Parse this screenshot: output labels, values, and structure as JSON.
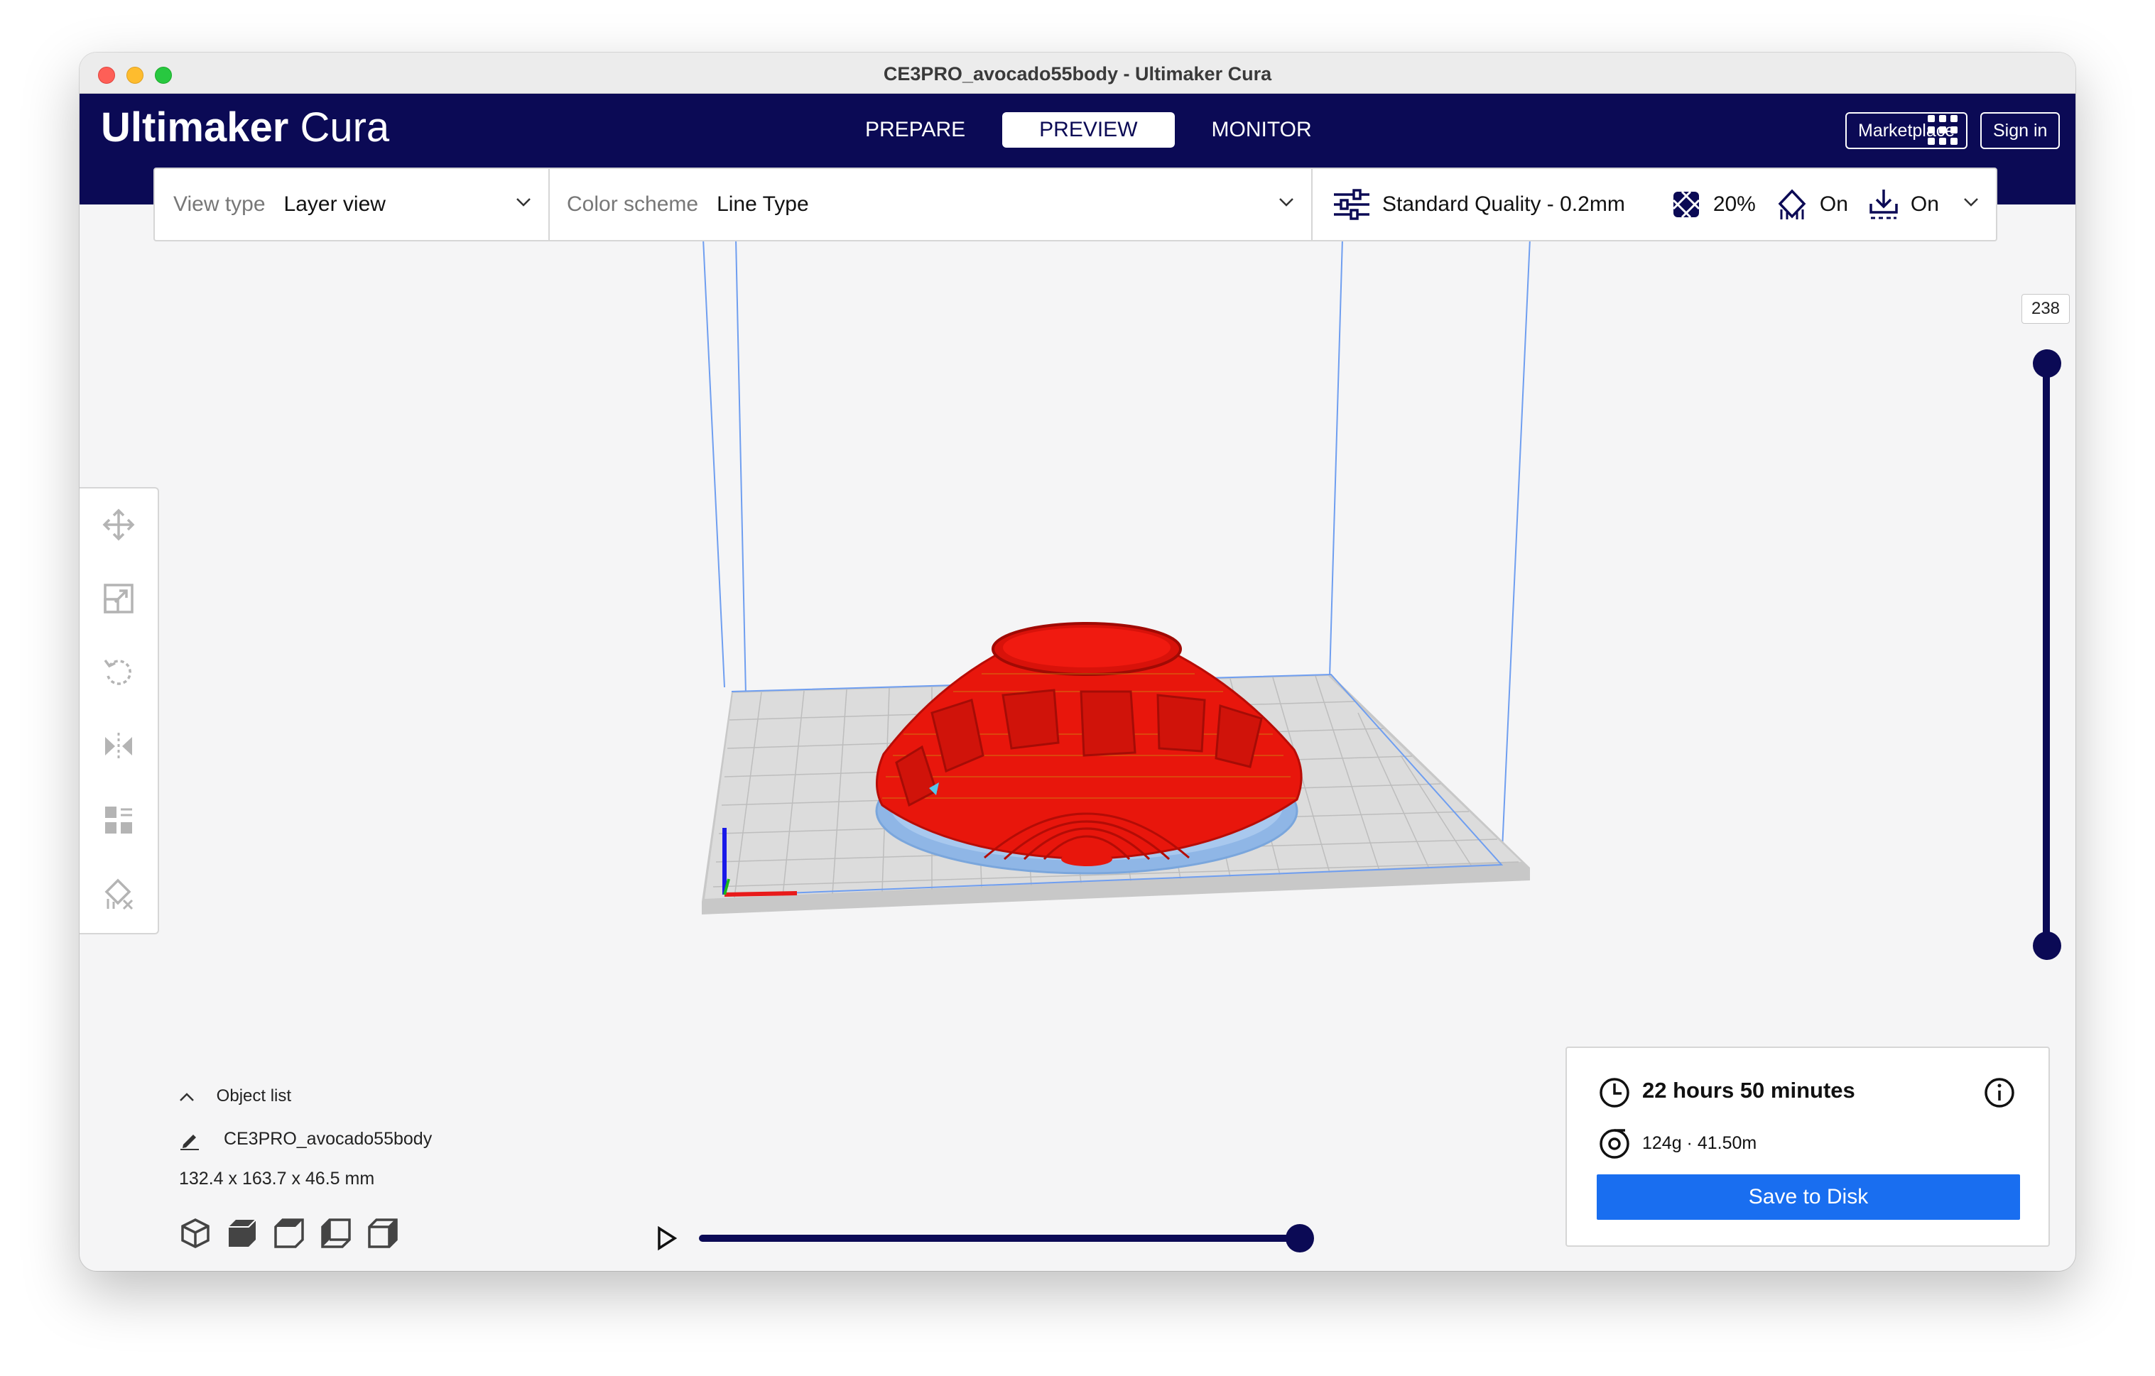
{
  "window": {
    "title": "CE3PRO_avocado55body - Ultimaker Cura"
  },
  "header": {
    "logo_bold": "Ultimaker",
    "logo_light": "Cura",
    "tabs": [
      {
        "label": "PREPARE",
        "active": false
      },
      {
        "label": "PREVIEW",
        "active": true
      },
      {
        "label": "MONITOR",
        "active": false
      }
    ],
    "marketplace_label": "Marketplace",
    "sign_in_label": "Sign in"
  },
  "toolbar": {
    "view_type_label": "View type",
    "view_type_value": "Layer view",
    "color_scheme_label": "Color scheme",
    "color_scheme_value": "Line Type",
    "quality": "Standard Quality - 0.2mm",
    "infill": "20%",
    "support": "On",
    "adhesion": "On"
  },
  "layer_slider": {
    "current_layer": "238",
    "top_fraction": 1.0,
    "bottom_fraction": 0.0
  },
  "object_list": {
    "heading": "Object list",
    "object_name": "CE3PRO_avocado55body",
    "dimensions": "132.4 x 163.7 x 46.5 mm"
  },
  "simulation": {
    "progress": 1.0
  },
  "print_info": {
    "time": "22 hours 50 minutes",
    "material": "124g · 41.50m",
    "save_label": "Save to Disk"
  },
  "colors": {
    "header_bg": "#0b0a55",
    "accent_blue": "#196ef0",
    "model_red": "#e8160c",
    "skirt_blue": "#8fb6e6"
  },
  "icons": {
    "tools": [
      "move-icon",
      "scale-icon",
      "rotate-icon",
      "mirror-icon",
      "per-model-settings-icon",
      "support-blocker-icon"
    ],
    "views": [
      "3d-view-icon",
      "front-view-icon",
      "top-view-icon",
      "left-view-icon",
      "right-view-icon"
    ]
  }
}
